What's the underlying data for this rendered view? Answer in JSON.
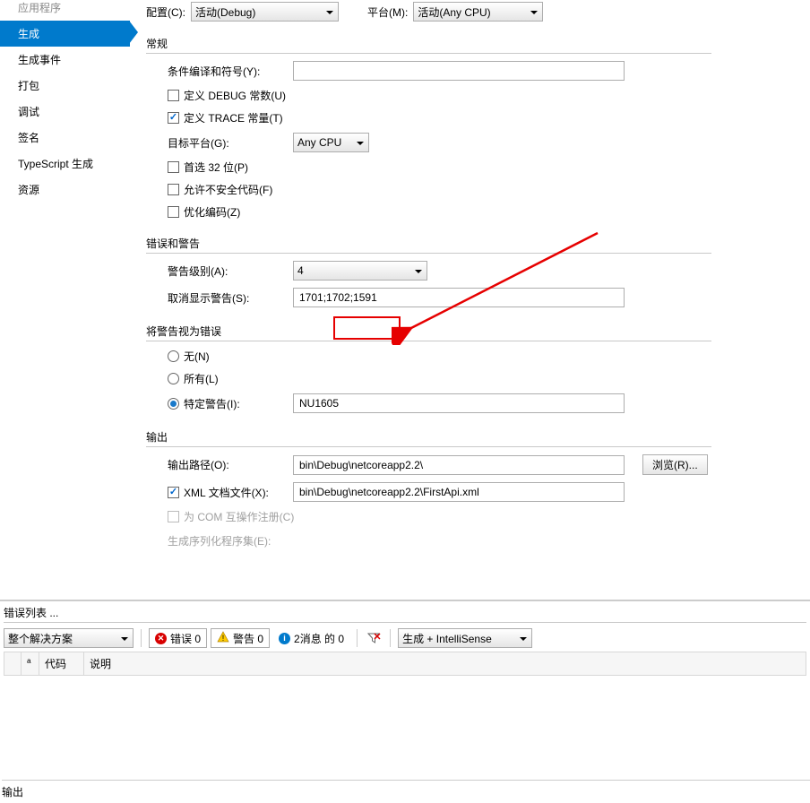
{
  "sidebar": {
    "items": [
      {
        "label": "应用程序"
      },
      {
        "label": "生成"
      },
      {
        "label": "生成事件"
      },
      {
        "label": "打包"
      },
      {
        "label": "调试"
      },
      {
        "label": "签名"
      },
      {
        "label": "TypeScript 生成"
      },
      {
        "label": "资源"
      }
    ]
  },
  "top": {
    "config_label": "配置(C):",
    "config_value": "活动(Debug)",
    "platform_label": "平台(M):",
    "platform_value": "活动(Any CPU)"
  },
  "general": {
    "title": "常规",
    "cond_symbols_label": "条件编译和符号(Y):",
    "cond_symbols_value": "",
    "define_debug": "定义 DEBUG 常数(U)",
    "define_trace": "定义 TRACE 常量(T)",
    "target_platform_label": "目标平台(G):",
    "target_platform_value": "Any CPU",
    "prefer32": "首选 32 位(P)",
    "allow_unsafe": "允许不安全代码(F)",
    "optimize": "优化编码(Z)"
  },
  "errors": {
    "title": "错误和警告",
    "warn_level_label": "警告级别(A):",
    "warn_level_value": "4",
    "suppress_label": "取消显示警告(S):",
    "suppress_value": "1701;1702;1591"
  },
  "treat": {
    "title": "将警告视为错误",
    "none": "无(N)",
    "all": "所有(L)",
    "specific": "特定警告(I):",
    "specific_value": "NU1605"
  },
  "output": {
    "title": "输出",
    "path_label": "输出路径(O):",
    "path_value": "bin\\Debug\\netcoreapp2.2\\",
    "browse": "浏览(R)...",
    "xml_doc": "XML 文档文件(X):",
    "xml_value": "bin\\Debug\\netcoreapp2.2\\FirstApi.xml",
    "com_interop": "为 COM 互操作注册(C)"
  },
  "errlist": {
    "title": "错误列表 ...",
    "scope": "整个解决方案",
    "errors": "错误 0",
    "warnings": "警告 0",
    "messages": "2消息 的 0",
    "filter": "生成 + IntelliSense",
    "col_code": "代码",
    "col_desc": "说明"
  },
  "out_panel": "输出"
}
